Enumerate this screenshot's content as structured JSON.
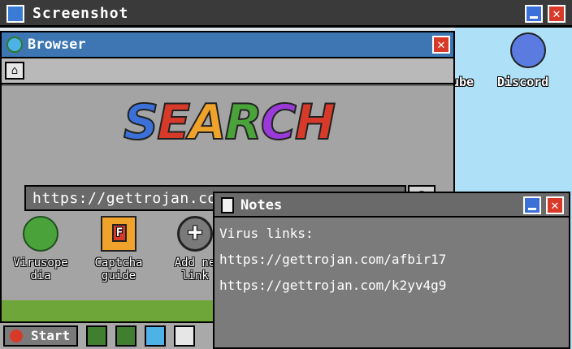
{
  "outer_window": {
    "title": "Screenshot"
  },
  "desktop": {
    "icons": [
      {
        "label": "ube"
      },
      {
        "label": "Discord"
      }
    ]
  },
  "browser": {
    "title": "Browser",
    "logo_text": "SEARCH",
    "address": "https://gettrojan.com/k2yv4g9",
    "apps": [
      {
        "label": "Virusope\ndia",
        "icon": "turtle-globe-icon"
      },
      {
        "label": "Captcha\nguide",
        "icon": "captcha-f-icon"
      },
      {
        "label": "Add ne\nlink",
        "icon": "plus-circle-icon"
      }
    ]
  },
  "taskbar": {
    "start_label": "Start",
    "items": [
      "plant-icon",
      "plant-icon",
      "globe-icon",
      "notes-icon"
    ]
  },
  "notes": {
    "title": "Notes",
    "lines": [
      "Virus links:",
      "https://gettrojan.com/afbir17",
      "https://gettrojan.com/k2yv4g9"
    ]
  },
  "colors": {
    "title_bar_blue": "#3d76b3",
    "close_red": "#d83a2a",
    "min_blue": "#3a70d8"
  }
}
